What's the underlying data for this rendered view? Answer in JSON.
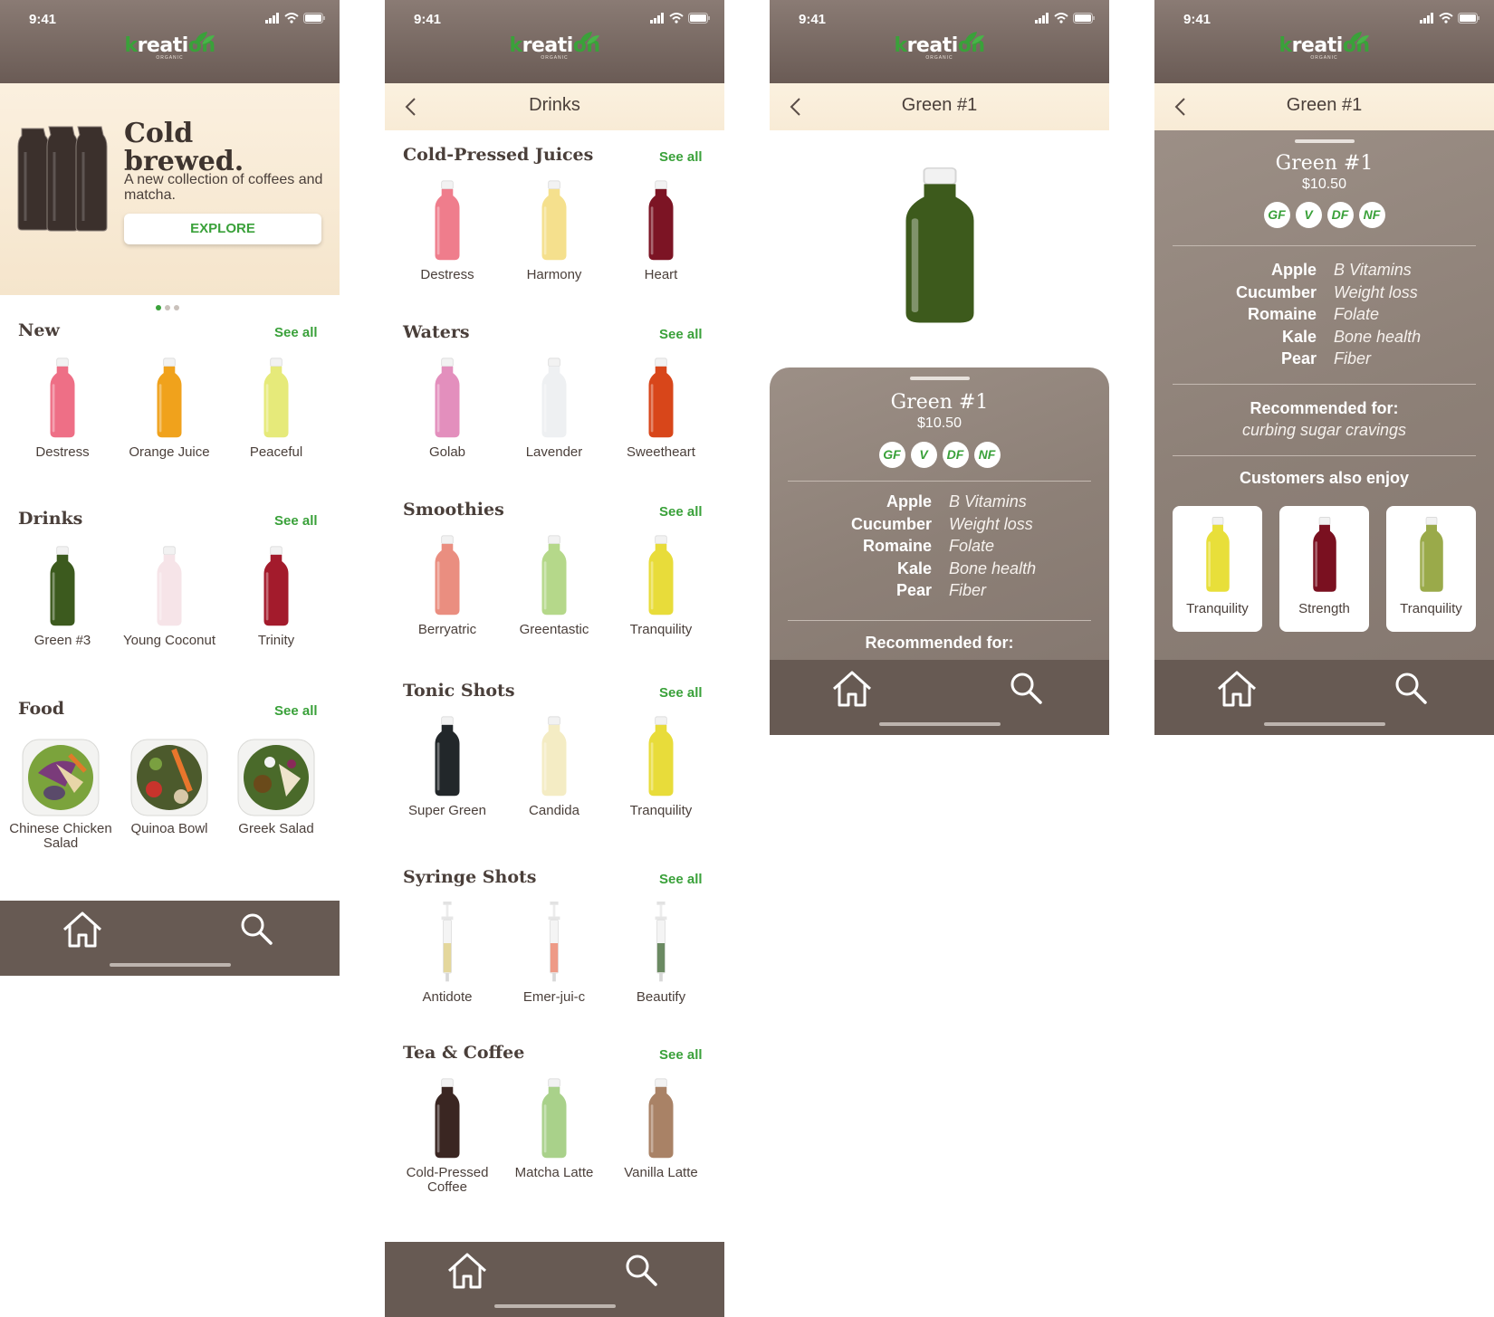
{
  "status": {
    "time": "9:41"
  },
  "brand": {
    "name_k": "k",
    "name_mid": "reati",
    "name_on": "on",
    "sub": "ORGANIC"
  },
  "colors": {
    "accent": "#3aa13a",
    "header": "#6a5b55",
    "tabbar": "#675a53",
    "cream": "#fbf0df"
  },
  "icons": [
    "signal-icon",
    "wifi-icon",
    "battery-icon",
    "back-chevron-icon",
    "home-icon",
    "search-icon",
    "leaf-icon"
  ],
  "home": {
    "hero": {
      "title_line1": "Cold",
      "title_line2": "brewed.",
      "subtitle": "A new collection of coffees and matcha.",
      "button": "EXPLORE"
    },
    "sections": [
      {
        "title": "New",
        "see_all": "See all",
        "items": [
          {
            "label": "Destress",
            "color": "#ee6f86"
          },
          {
            "label": "Orange Juice",
            "color": "#f0a21c"
          },
          {
            "label": "Peaceful",
            "color": "#e6ea7a"
          }
        ]
      },
      {
        "title": "Drinks",
        "see_all": "See all",
        "items": [
          {
            "label": "Green #3",
            "color": "#3c5a1e"
          },
          {
            "label": "Young Coconut",
            "color": "#f6e4e8"
          },
          {
            "label": "Trinity",
            "color": "#a31b2c"
          }
        ]
      },
      {
        "title": "Food",
        "see_all": "See all",
        "items": [
          {
            "label": "Chinese Chicken Salad"
          },
          {
            "label": "Quinoa Bowl"
          },
          {
            "label": "Greek Salad"
          }
        ]
      }
    ]
  },
  "drinks": {
    "title": "Drinks",
    "sections": [
      {
        "title": "Cold-Pressed Juices",
        "see_all": "See all",
        "items": [
          {
            "label": "Destress",
            "color": "#ef7d8c"
          },
          {
            "label": "Harmony",
            "color": "#f5e08d"
          },
          {
            "label": "Heart",
            "color": "#7c1424"
          }
        ]
      },
      {
        "title": "Waters",
        "see_all": "See all",
        "items": [
          {
            "label": "Golab",
            "color": "#e38fbd"
          },
          {
            "label": "Lavender",
            "color": "#eef0f2"
          },
          {
            "label": "Sweetheart",
            "color": "#d8461a"
          }
        ]
      },
      {
        "title": "Smoothies",
        "see_all": "See all",
        "items": [
          {
            "label": "Berryatric",
            "color": "#ea8e80"
          },
          {
            "label": "Greentastic",
            "color": "#b5d88a"
          },
          {
            "label": "Tranquility",
            "color": "#e8dc3a"
          }
        ]
      },
      {
        "title": "Tonic Shots",
        "see_all": "See all",
        "items": [
          {
            "label": "Super Green",
            "color": "#22272a"
          },
          {
            "label": "Candida",
            "color": "#f4ecc4"
          },
          {
            "label": "Tranquility",
            "color": "#e8dc3a"
          }
        ]
      },
      {
        "title": "Syringe Shots",
        "see_all": "See all",
        "items": [
          {
            "label": "Antidote",
            "color": "#e4d79c"
          },
          {
            "label": "Emer-jui-c",
            "color": "#ee9a86"
          },
          {
            "label": "Beautify",
            "color": "#6b8a62"
          }
        ]
      },
      {
        "title": "Tea & Coffee",
        "see_all": "See all",
        "items": [
          {
            "label": "Cold-Pressed Coffee",
            "color": "#3a2622"
          },
          {
            "label": "Matcha Latte",
            "color": "#a9d18a"
          },
          {
            "label": "Vanilla Latte",
            "color": "#a98266"
          }
        ]
      }
    ]
  },
  "product": {
    "nav_title": "Green #1",
    "name": "Green #1",
    "price": "$10.50",
    "color": "#3d5a1c",
    "badges": [
      "GF",
      "V",
      "DF",
      "NF"
    ],
    "ingredients": [
      "Apple",
      "Cucumber",
      "Romaine",
      "Kale",
      "Pear"
    ],
    "benefits": [
      "B Vitamins",
      "Weight loss",
      "Folate",
      "Bone health",
      "Fiber"
    ],
    "recommended_label": "Recommended for:",
    "recommended_value": "curbing sugar cravings",
    "also_enjoy_label": "Customers also enjoy",
    "also_enjoy": [
      {
        "label": "Tranquility",
        "color": "#e8df3a"
      },
      {
        "label": "Strength",
        "color": "#7a1020"
      },
      {
        "label": "Tranquility",
        "color": "#9aaa4a"
      }
    ]
  }
}
